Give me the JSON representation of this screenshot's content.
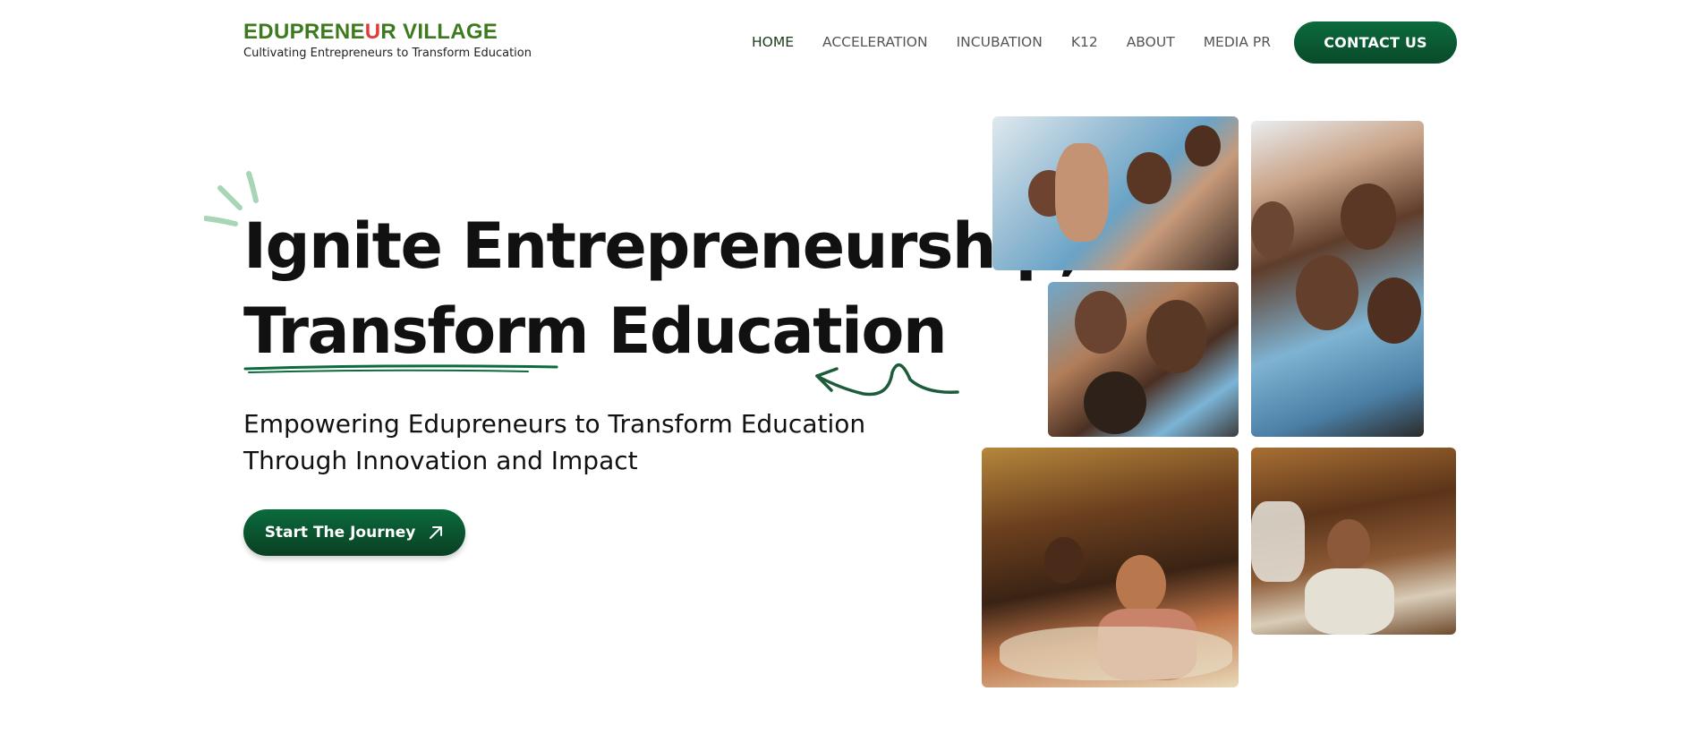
{
  "header": {
    "logo": {
      "title_part1": "EDUPRENE",
      "title_highlight": "U",
      "title_part2": "R VILLAGE",
      "tagline": "Cultivating Entrepreneurs to Transform Education"
    },
    "nav": [
      {
        "label": "HOME",
        "active": true
      },
      {
        "label": "ACCELERATION",
        "active": false
      },
      {
        "label": "INCUBATION",
        "active": false
      },
      {
        "label": "K12",
        "active": false
      },
      {
        "label": "ABOUT",
        "active": false
      },
      {
        "label": "MEDIA PR",
        "active": false
      }
    ],
    "contact_label": "CONTACT US"
  },
  "hero": {
    "headline_line1": "Ignite Entrepreneurship,",
    "headline_line2": "Transform Education",
    "subhead_line1": "Empowering Edupreneurs to Transform Education",
    "subhead_line2": "Through Innovation and Impact",
    "cta_label": "Start The Journey",
    "cta_icon": "arrow-up-right-icon"
  },
  "colors": {
    "brand_green": "#0b6b3d",
    "logo_green": "#3d7a1f",
    "logo_red": "#e03a3a",
    "accent_light_green": "#a8d5b5"
  },
  "gallery": [
    {
      "name": "students-waving-photo"
    },
    {
      "name": "students-group-tall-photo"
    },
    {
      "name": "students-smiling-photo"
    },
    {
      "name": "conference-audience-photo"
    },
    {
      "name": "conference-attendee-photo"
    }
  ]
}
